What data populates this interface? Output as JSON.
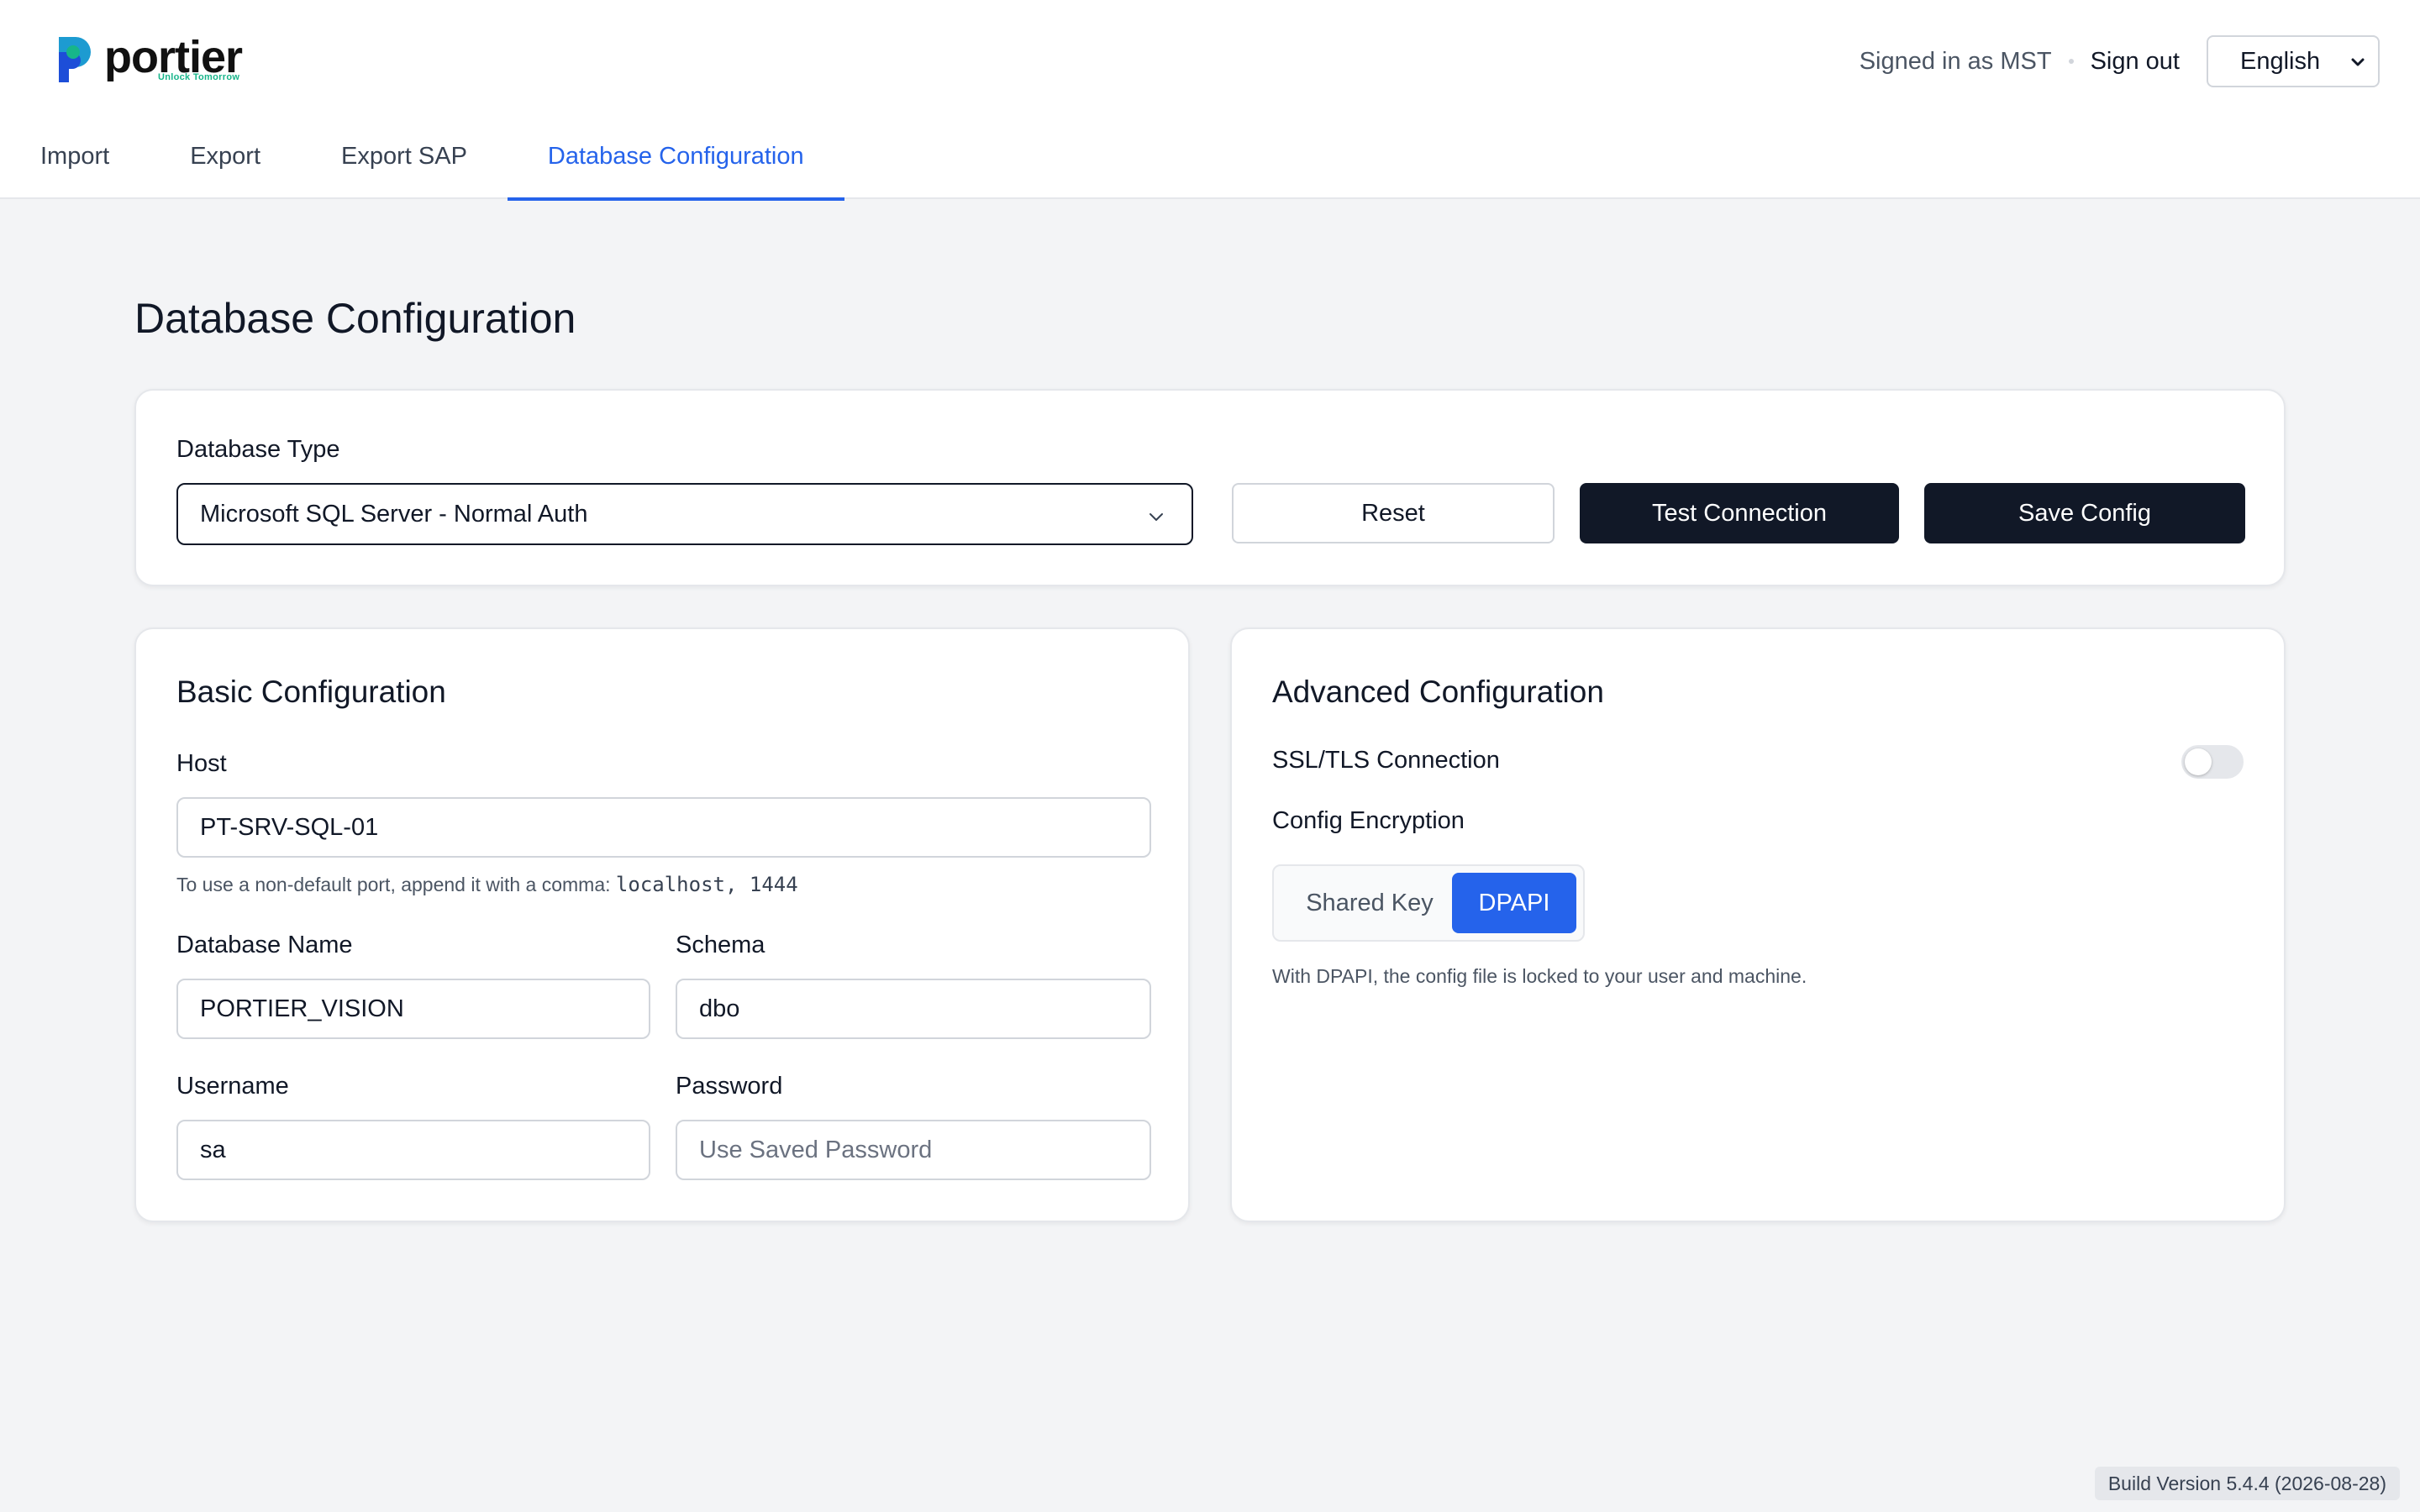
{
  "brand": {
    "name": "portier",
    "tagline": "Unlock Tomorrow",
    "colors": {
      "primary": "#2563eb",
      "dark": "#111827",
      "logo_green": "#17b58a",
      "logo_blue": "#1d4ed8"
    }
  },
  "header": {
    "signed_in": "Signed in as MST",
    "sign_out": "Sign out",
    "language": "English"
  },
  "tabs": [
    {
      "label": "Import"
    },
    {
      "label": "Export"
    },
    {
      "label": "Export SAP"
    },
    {
      "label": "Database Configuration",
      "active": true
    }
  ],
  "page": {
    "title": "Database Configuration"
  },
  "top": {
    "db_type_label": "Database Type",
    "db_type_value": "Microsoft SQL Server - Normal Auth",
    "reset": "Reset",
    "test_connection": "Test Connection",
    "save_config": "Save Config"
  },
  "basic": {
    "title": "Basic Configuration",
    "host_label": "Host",
    "host_value": "PT-SRV-SQL-01",
    "host_hint": "To use a non-default port, append it with a comma:",
    "host_hint_code": "localhost, 1444",
    "db_name_label": "Database Name",
    "db_name_value": "PORTIER_VISION",
    "schema_label": "Schema",
    "schema_value": "dbo",
    "username_label": "Username",
    "username_value": "sa",
    "password_label": "Password",
    "password_placeholder": "Use Saved Password"
  },
  "advanced": {
    "title": "Advanced Configuration",
    "ssl_label": "SSL/TLS Connection",
    "ssl_enabled": false,
    "encryption_label": "Config Encryption",
    "encryption_options": [
      "Shared Key",
      "DPAPI"
    ],
    "encryption_selected": "DPAPI",
    "encryption_hint": "With DPAPI, the config file is locked to your user and machine."
  },
  "footer": {
    "build": "Build Version 5.4.4 (2026-08-28)"
  }
}
